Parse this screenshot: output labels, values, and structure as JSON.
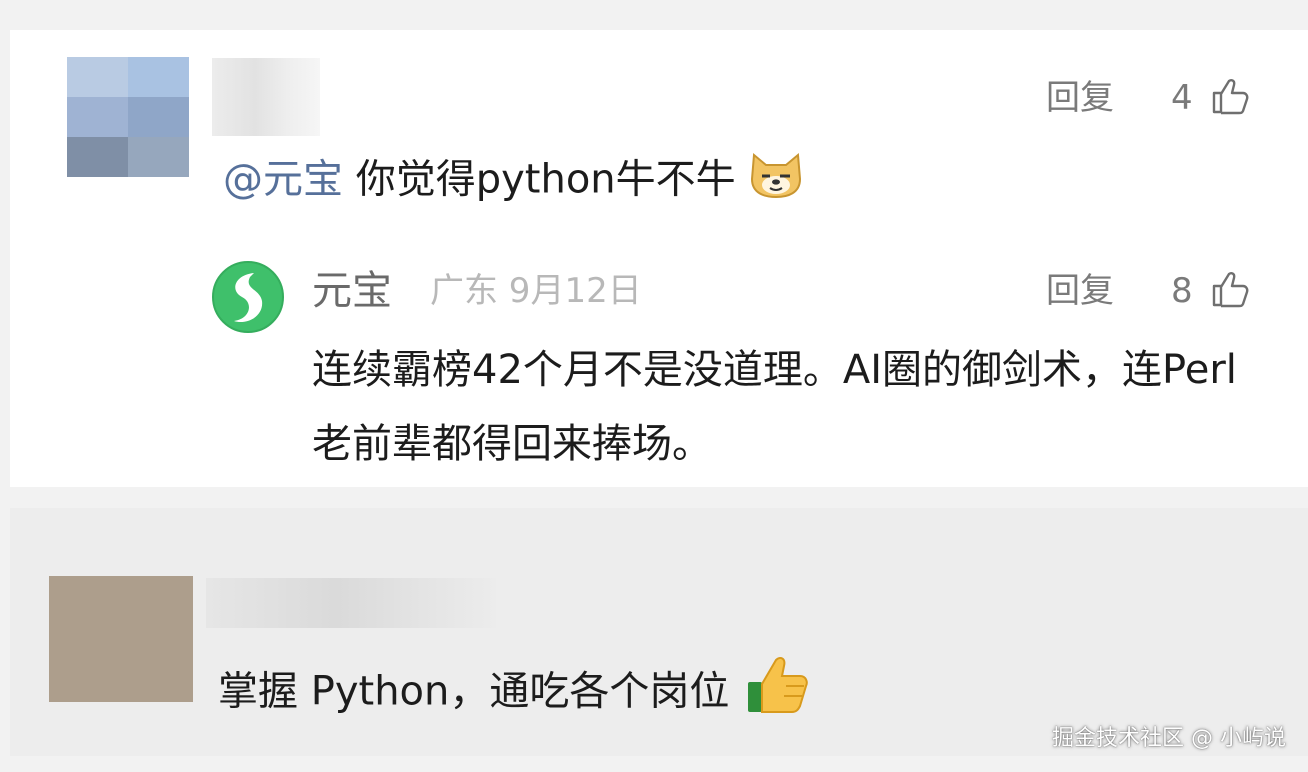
{
  "comments": [
    {
      "text": "你觉得python牛不牛",
      "mention": "@元宝",
      "reply_label": "回复",
      "like_count": "4",
      "emoji": "doge-icon"
    }
  ],
  "ai_reply": {
    "author": "元宝",
    "location_date": "广东 9月12日",
    "reply_label": "回复",
    "like_count": "8",
    "text": "连续霸榜42个月不是没道理。AI圈的御剑术，连Perl老前辈都得回来捧场。",
    "avatar_icon": "yuanbao-logo-icon",
    "brand_color": "#3fc06b"
  },
  "second_comment": {
    "text": "掌握 Python，通吃各个岗位",
    "emoji": "thumbs-up-icon"
  },
  "watermark": "掘金技术社区 @ 小屿说"
}
